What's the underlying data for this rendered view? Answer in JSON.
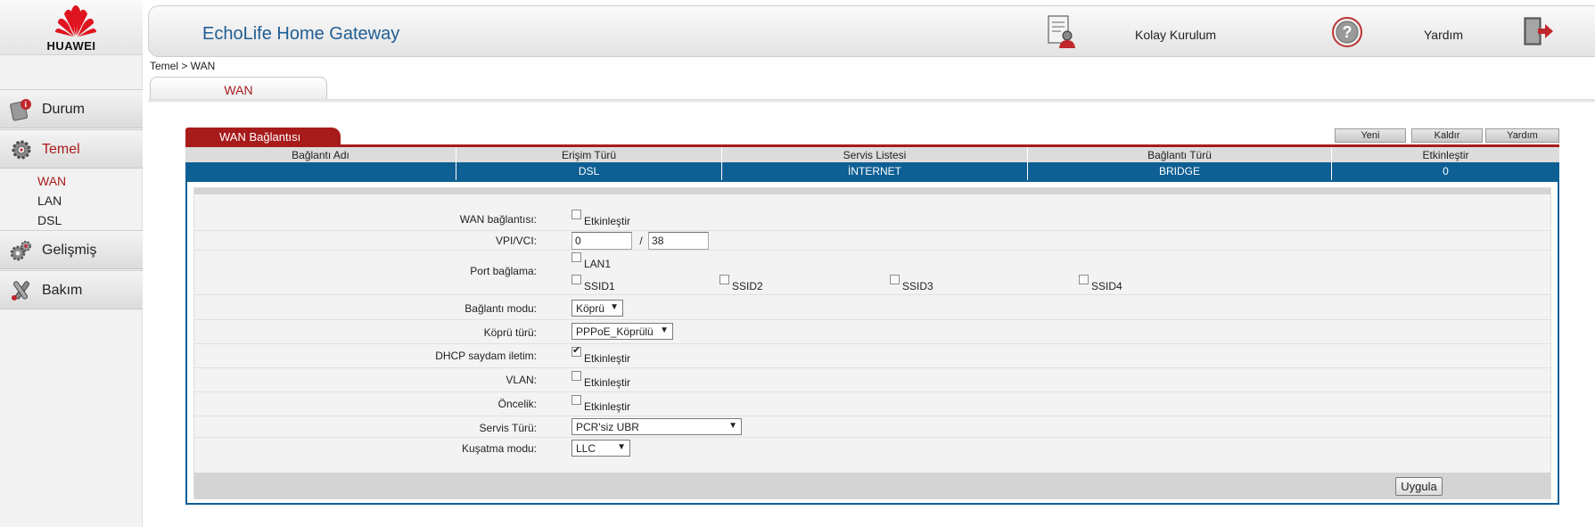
{
  "brand": {
    "name": "HUAWEI"
  },
  "header": {
    "title": "EchoLife Home Gateway",
    "quick_setup": "Kolay Kurulum",
    "help": "Yardım"
  },
  "sidebar": {
    "sections": [
      {
        "label": "Durum",
        "icon": "status-info-icon"
      },
      {
        "label": "Temel",
        "icon": "gear-icon",
        "active": true
      },
      {
        "label": "Gelişmiş",
        "icon": "advanced-gears-icon"
      },
      {
        "label": "Bakım",
        "icon": "maintenance-tools-icon"
      }
    ],
    "subitems": [
      {
        "label": "WAN",
        "active": true
      },
      {
        "label": "LAN"
      },
      {
        "label": "DSL"
      }
    ]
  },
  "breadcrumb": "Temel > WAN",
  "tab": "WAN",
  "wan": {
    "section_title": "WAN Bağlantısı",
    "buttons": {
      "new": "Yeni",
      "remove": "Kaldır",
      "help": "Yardım"
    },
    "columns": [
      "Bağlantı Adı",
      "Erişim Türü",
      "Servis Listesi",
      "Bağlantı Türü",
      "Etkinleştir"
    ],
    "row": [
      "",
      "DSL",
      "İNTERNET",
      "BRIDGE",
      "0"
    ]
  },
  "form": {
    "wan_connection": {
      "label": "WAN bağlantısı:",
      "option": "Etkinleştir",
      "checked": false
    },
    "vpi_vci": {
      "label": "VPI/VCI:",
      "vpi": "0",
      "separator": "/",
      "vci": "38"
    },
    "port_binding": {
      "label": "Port bağlama:",
      "options": [
        "LAN1",
        "SSID1",
        "SSID2",
        "SSID3",
        "SSID4"
      ]
    },
    "connection_mode": {
      "label": "Bağlantı modu:",
      "value": "Köprü"
    },
    "bridge_type": {
      "label": "Köprü türü:",
      "value": "PPPoE_Köprülü"
    },
    "dhcp_transparent": {
      "label": "DHCP saydam iletim:",
      "option": "Etkinleştir",
      "checked": true
    },
    "vlan": {
      "label": "VLAN:",
      "option": "Etkinleştir",
      "checked": false
    },
    "priority": {
      "label": "Öncelik:",
      "option": "Etkinleştir",
      "checked": false
    },
    "service_type": {
      "label": "Servis Türü:",
      "value": "PCR'siz UBR"
    },
    "encapsulation": {
      "label": "Kuşatma modu:",
      "value": "LLC"
    },
    "apply": "Uygula"
  },
  "colors": {
    "accent": "#a81b1b",
    "table_blue": "#0e5f94",
    "title_blue": "#1f5e94"
  }
}
